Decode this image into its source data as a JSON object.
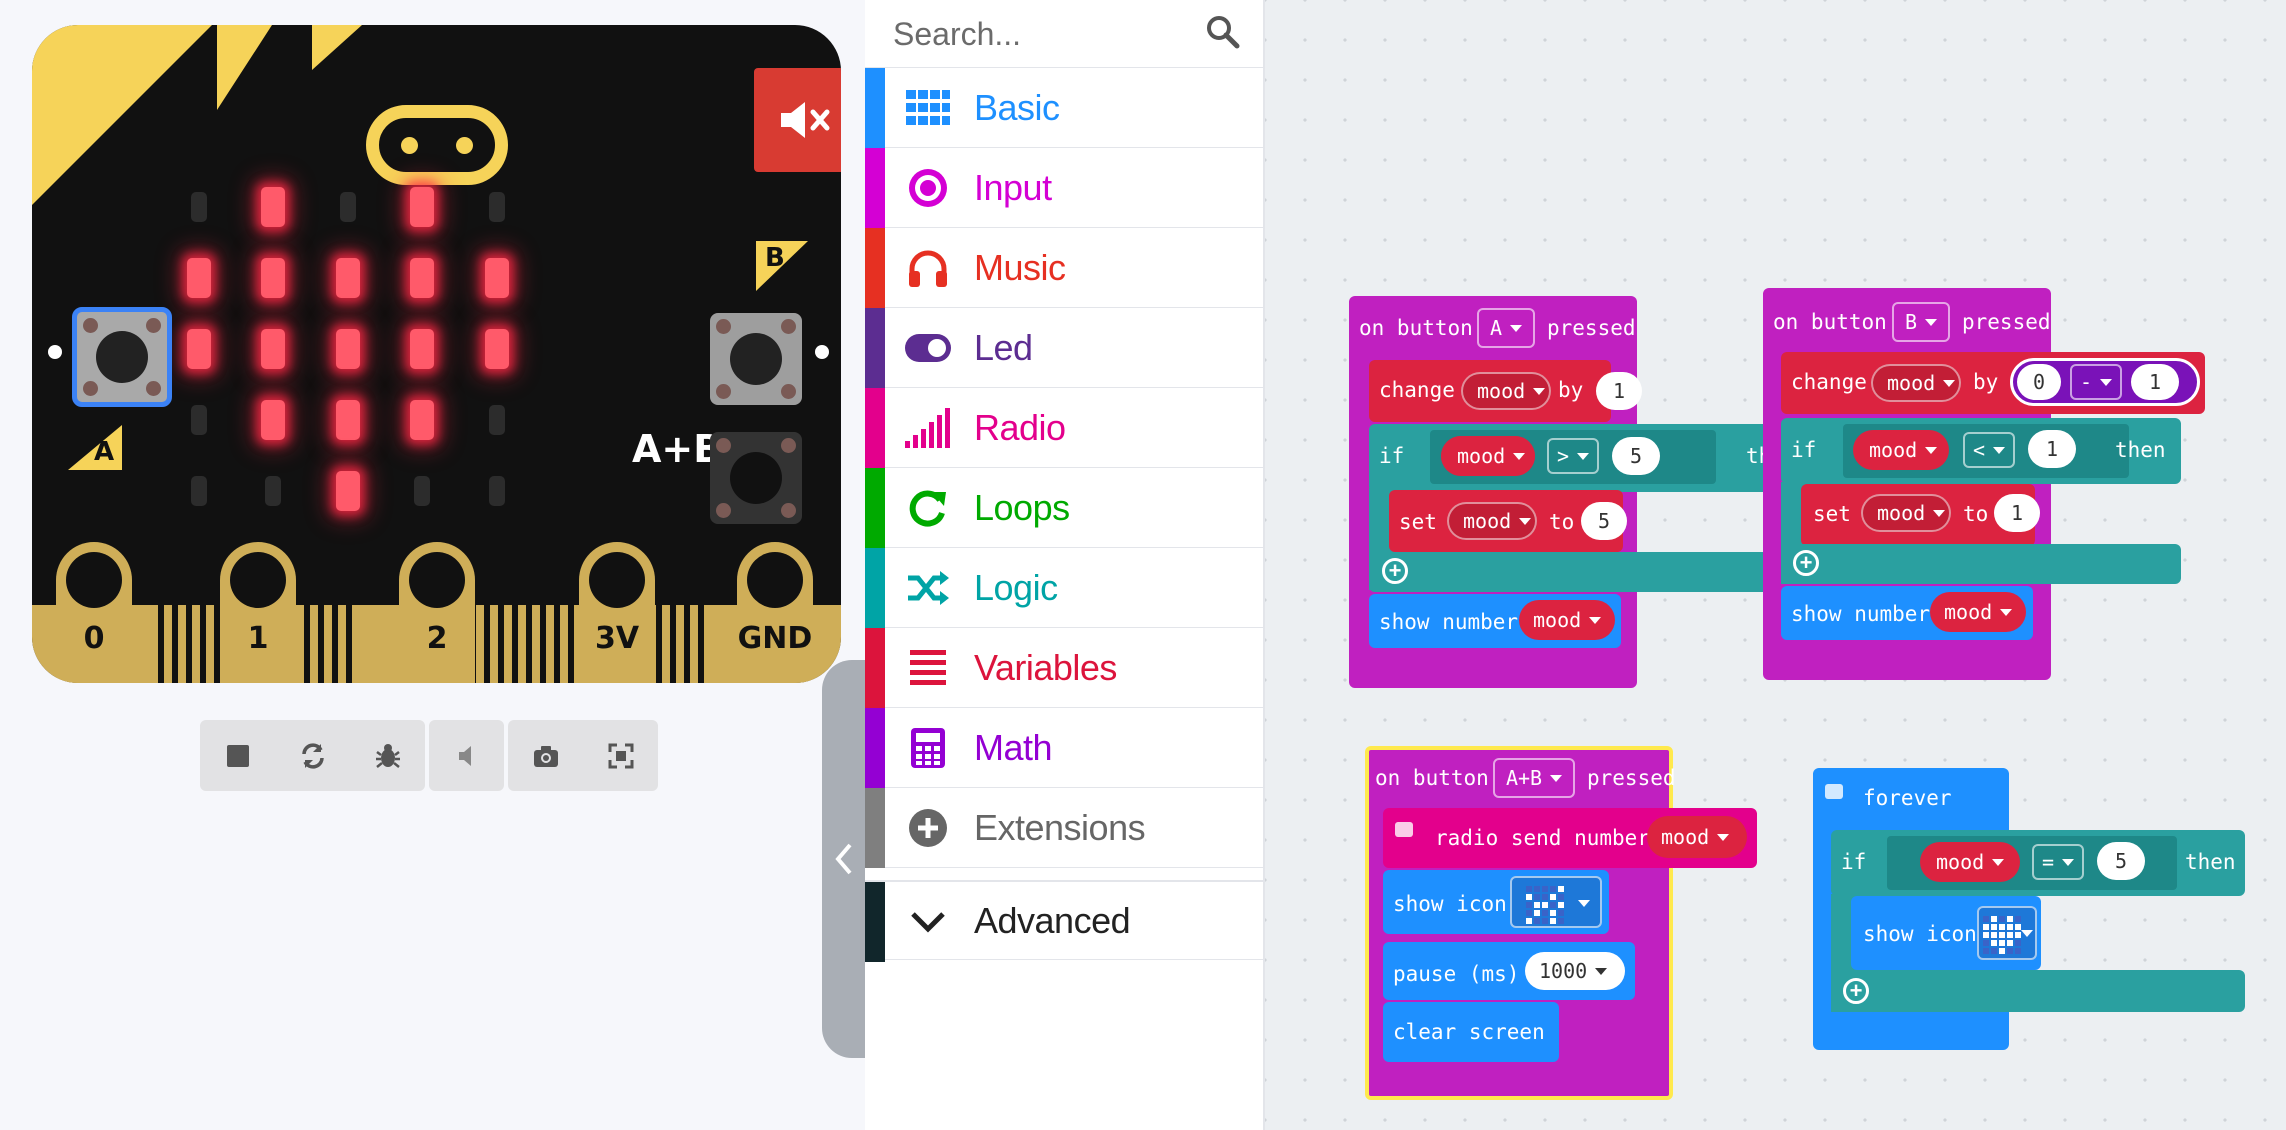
{
  "simulator": {
    "pins": [
      "0",
      "1",
      "2",
      "3V",
      "GND"
    ],
    "button_a": "A",
    "button_b": "B",
    "button_ab": "A+B",
    "led_matrix": [
      [
        0,
        1,
        0,
        1,
        0
      ],
      [
        1,
        1,
        1,
        1,
        1
      ],
      [
        1,
        1,
        1,
        1,
        1
      ],
      [
        0,
        1,
        1,
        1,
        0
      ],
      [
        0,
        0,
        1,
        0,
        0
      ]
    ],
    "colors": {
      "board": "#111111",
      "accent": "#f6d359",
      "led_on": "#ff5a6a",
      "mute": "#d83b32"
    }
  },
  "sim_toolbar": {
    "icons": [
      "stop-icon",
      "restart-icon",
      "debug-icon",
      "mute-icon",
      "screenshot-icon",
      "fullscreen-icon"
    ]
  },
  "toolbox": {
    "search_placeholder": "Search...",
    "categories": [
      {
        "label": "Basic",
        "color": "#1e90ff",
        "icon": "grid-icon"
      },
      {
        "label": "Input",
        "color": "#d400d4",
        "icon": "input-icon"
      },
      {
        "label": "Music",
        "color": "#e63022",
        "icon": "headphones-icon"
      },
      {
        "label": "Led",
        "color": "#5c2d91",
        "icon": "toggle-icon"
      },
      {
        "label": "Radio",
        "color": "#e3008c",
        "icon": "signal-icon"
      },
      {
        "label": "Loops",
        "color": "#00aa00",
        "icon": "loop-icon"
      },
      {
        "label": "Logic",
        "color": "#00a4a6",
        "icon": "shuffle-icon"
      },
      {
        "label": "Variables",
        "color": "#dc143c",
        "icon": "list-icon"
      },
      {
        "label": "Math",
        "color": "#9400d3",
        "icon": "calculator-icon"
      },
      {
        "label": "Extensions",
        "color": "#7f7f7f",
        "icon": "plus-circle-icon"
      },
      {
        "label": "Advanced",
        "color": "#222222",
        "icon": "chevron-down-icon"
      }
    ]
  },
  "workspace": {
    "on_a": {
      "prefix": "on button",
      "button": "A",
      "suffix": "pressed",
      "change": "change",
      "var": "mood",
      "by": "by",
      "by_val": "1",
      "if": "if",
      "cmp": ">",
      "cmp_val": "5",
      "then": "then",
      "set": "set",
      "to": "to",
      "set_val": "5",
      "show_number": "show number"
    },
    "on_b": {
      "prefix": "on button",
      "button": "B",
      "suffix": "pressed",
      "change": "change",
      "var": "mood",
      "by": "by",
      "math_a": "0",
      "math_op": "-",
      "math_b": "1",
      "if": "if",
      "cmp": "<",
      "cmp_val": "1",
      "then": "then",
      "set": "set",
      "to": "to",
      "set_val": "1",
      "show_number": "show number"
    },
    "on_ab": {
      "prefix": "on button",
      "button": "A+B",
      "suffix": "pressed",
      "radio_send": "radio send number",
      "var": "mood",
      "show_icon": "show icon",
      "pause": "pause (ms)",
      "pause_val": "1000",
      "clear": "clear screen"
    },
    "forever": {
      "label": "forever",
      "if": "if",
      "var": "mood",
      "cmp": "=",
      "cmp_val": "5",
      "then": "then",
      "show_icon": "show icon"
    }
  }
}
